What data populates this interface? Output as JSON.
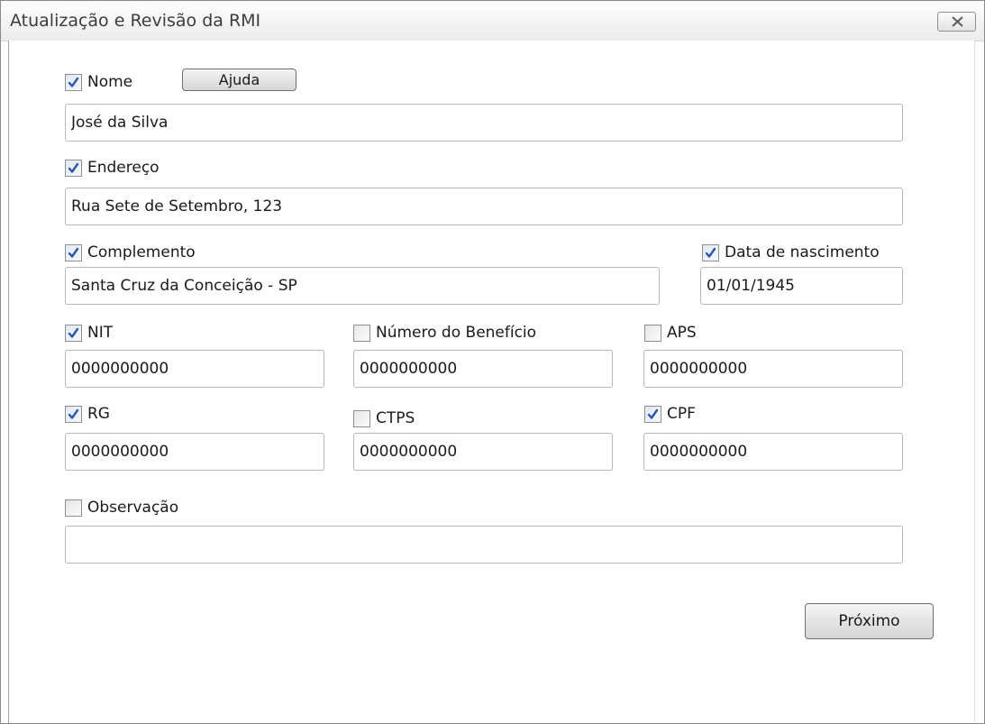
{
  "window": {
    "title": "Atualização e Revisão da RMI"
  },
  "form": {
    "nome": {
      "label": "Nome",
      "checked": true,
      "value": "José da Silva"
    },
    "ajuda_label": "Ajuda",
    "endereco": {
      "label": "Endereço",
      "checked": true,
      "value": "Rua Sete de Setembro, 123"
    },
    "complemento": {
      "label": "Complemento",
      "checked": true,
      "value": "Santa Cruz da Conceição - SP"
    },
    "data_nascimento": {
      "label": "Data de nascimento",
      "checked": true,
      "value": "01/01/1945"
    },
    "nit": {
      "label": "NIT",
      "checked": true,
      "value": "0000000000"
    },
    "numero_beneficio": {
      "label": "Número do Benefício",
      "checked": false,
      "value": "0000000000"
    },
    "aps": {
      "label": "APS",
      "checked": false,
      "value": "0000000000"
    },
    "rg": {
      "label": "RG",
      "checked": true,
      "value": "0000000000"
    },
    "ctps": {
      "label": "CTPS",
      "checked": false,
      "value": "0000000000"
    },
    "cpf": {
      "label": "CPF",
      "checked": true,
      "value": "0000000000"
    },
    "observacao": {
      "label": "Observação",
      "checked": false,
      "value": ""
    },
    "proximo_label": "Próximo"
  }
}
